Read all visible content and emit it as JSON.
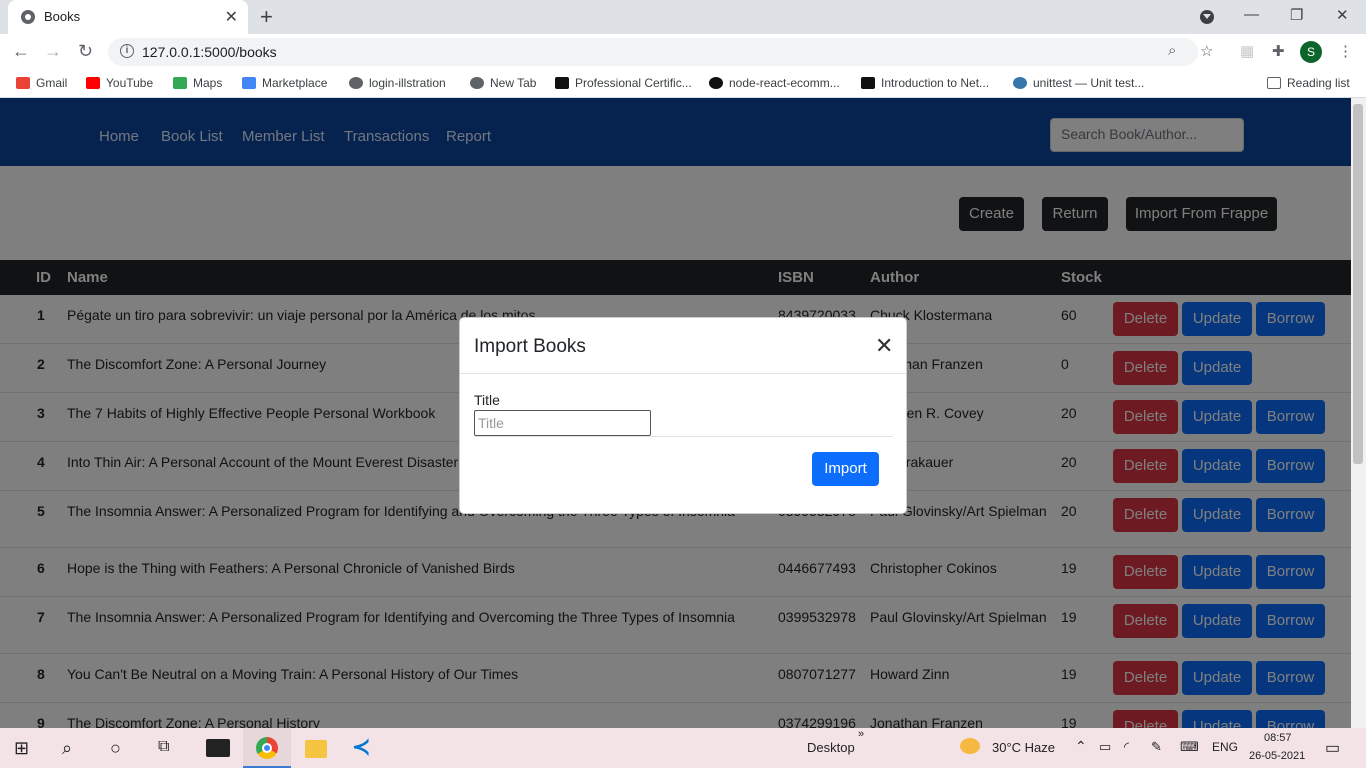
{
  "browser": {
    "tab_title": "Books",
    "url": "127.0.0.1:5000/books",
    "profile_initial": "S",
    "bookmarks": [
      {
        "label": "Gmail",
        "icon": "gmail-icon",
        "color": "#ea4335"
      },
      {
        "label": "YouTube",
        "icon": "youtube-icon",
        "color": "#ff0000"
      },
      {
        "label": "Maps",
        "icon": "maps-icon",
        "color": "#34a853"
      },
      {
        "label": "Marketplace",
        "icon": "marketplace-icon",
        "color": "#4285f4"
      },
      {
        "label": "login-illstration",
        "icon": "globe-icon",
        "color": "#5f6368"
      },
      {
        "label": "New Tab",
        "icon": "globe-icon",
        "color": "#5f6368"
      },
      {
        "label": "Professional Certific...",
        "icon": "x-logo-icon",
        "color": "#111111"
      },
      {
        "label": "node-react-ecomm...",
        "icon": "github-icon",
        "color": "#111111"
      },
      {
        "label": "Introduction to Net...",
        "icon": "x-logo-icon",
        "color": "#111111"
      },
      {
        "label": "unittest — Unit test...",
        "icon": "python-icon",
        "color": "#3776ab"
      }
    ],
    "reading_list": "Reading list"
  },
  "nav": {
    "links": [
      "Home",
      "Book List",
      "Member List",
      "Transactions",
      "Report"
    ],
    "search_placeholder": "Search Book/Author..."
  },
  "actions": {
    "create": "Create",
    "return": "Return",
    "import": "Import From Frappe"
  },
  "table": {
    "headers": {
      "id": "ID",
      "name": "Name",
      "isbn": "ISBN",
      "author": "Author",
      "stock": "Stock"
    },
    "rows": [
      {
        "id": "1",
        "name": "Pégate un tiro para sobrevivir: un viaje personal por la América de los mitos",
        "isbn": "8439720033",
        "author": "Chuck Klostermana",
        "stock": "60",
        "borrow": true
      },
      {
        "id": "2",
        "name": "The Discomfort Zone: A Personal Journey",
        "isbn": "",
        "author": "Jonathan Franzen",
        "stock": "0",
        "borrow": false
      },
      {
        "id": "3",
        "name": "The 7 Habits of Highly Effective People Personal Workbook",
        "isbn": "",
        "author": "Stephen R. Covey",
        "stock": "20",
        "borrow": true
      },
      {
        "id": "4",
        "name": "Into Thin Air: A Personal Account of the Mount Everest Disaster",
        "isbn": "",
        "author": "Jon Krakauer",
        "stock": "20",
        "borrow": true
      },
      {
        "id": "5",
        "name": "The Insomnia Answer: A Personalized Program for Identifying and Overcoming the Three Types of Insomnia",
        "isbn": "0399532978",
        "author": "Paul Glovinsky/Art Spielman",
        "stock": "20",
        "borrow": true
      },
      {
        "id": "6",
        "name": "Hope is the Thing with Feathers: A Personal Chronicle of Vanished Birds",
        "isbn": "0446677493",
        "author": "Christopher Cokinos",
        "stock": "19",
        "borrow": true
      },
      {
        "id": "7",
        "name": "The Insomnia Answer: A Personalized Program for Identifying and Overcoming the Three Types of Insomnia",
        "isbn": "0399532978",
        "author": "Paul Glovinsky/Art Spielman",
        "stock": "19",
        "borrow": true
      },
      {
        "id": "8",
        "name": "You Can't Be Neutral on a Moving Train: A Personal History of Our Times",
        "isbn": "0807071277",
        "author": "Howard Zinn",
        "stock": "19",
        "borrow": true
      },
      {
        "id": "9",
        "name": "The Discomfort Zone: A Personal History",
        "isbn": "0374299196",
        "author": "Jonathan Franzen",
        "stock": "19",
        "borrow": true
      }
    ],
    "delete_label": "Delete",
    "update_label": "Update",
    "borrow_label": "Borrow"
  },
  "modal": {
    "title": "Import Books",
    "field_label": "Title",
    "placeholder": "Title",
    "submit": "Import"
  },
  "taskbar": {
    "desktop": "Desktop",
    "weather": "30°C  Haze",
    "lang": "ENG",
    "time": "08:57",
    "date": "26-05-2021"
  }
}
